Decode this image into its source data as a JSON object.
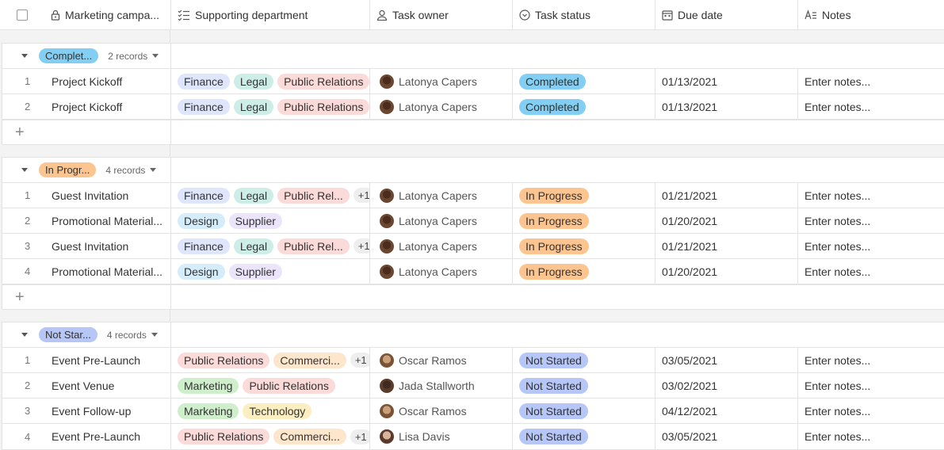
{
  "header": {
    "name_col": "Marketing campa...",
    "dept_col": "Supporting department",
    "owner_col": "Task owner",
    "status_col": "Task status",
    "due_col": "Due date",
    "notes_col": "Notes"
  },
  "colors": {
    "Finance": "#dfe6fb",
    "Legal": "#cdeee7",
    "Public Relations": "#fbdada",
    "Public Rel...": "#fbdada",
    "Design": "#d5ecfb",
    "Supplier": "#ece4fb",
    "Commerci...": "#fde6cc",
    "Marketing": "#cfeecc",
    "Technology": "#fbeec0",
    "Completed": "#82cff3",
    "In Progress": "#fcc48e",
    "Not Started": "#b5c6f7"
  },
  "groups": [
    {
      "label": "Complet...",
      "count": "2 records",
      "rows": [
        {
          "num": "1",
          "name": "Project Kickoff",
          "depts": [
            "Finance",
            "Legal",
            "Public Relations"
          ],
          "more": "",
          "owner": "Latonya Capers",
          "status": "Completed",
          "due": "01/13/2021",
          "notes": "Enter notes..."
        },
        {
          "num": "2",
          "name": "Project Kickoff",
          "depts": [
            "Finance",
            "Legal",
            "Public Relations"
          ],
          "more": "",
          "owner": "Latonya Capers",
          "status": "Completed",
          "due": "01/13/2021",
          "notes": "Enter notes..."
        }
      ]
    },
    {
      "label": "In Progr...",
      "count": "4 records",
      "rows": [
        {
          "num": "1",
          "name": "Guest Invitation",
          "depts": [
            "Finance",
            "Legal",
            "Public Rel..."
          ],
          "more": "+1",
          "owner": "Latonya Capers",
          "status": "In Progress",
          "due": "01/21/2021",
          "notes": "Enter notes..."
        },
        {
          "num": "2",
          "name": "Promotional Material...",
          "depts": [
            "Design",
            "Supplier"
          ],
          "more": "",
          "owner": "Latonya Capers",
          "status": "In Progress",
          "due": "01/20/2021",
          "notes": "Enter notes..."
        },
        {
          "num": "3",
          "name": "Guest Invitation",
          "depts": [
            "Finance",
            "Legal",
            "Public Rel..."
          ],
          "more": "+1",
          "owner": "Latonya Capers",
          "status": "In Progress",
          "due": "01/21/2021",
          "notes": "Enter notes..."
        },
        {
          "num": "4",
          "name": "Promotional Material...",
          "depts": [
            "Design",
            "Supplier"
          ],
          "more": "",
          "owner": "Latonya Capers",
          "status": "In Progress",
          "due": "01/20/2021",
          "notes": "Enter notes..."
        }
      ]
    },
    {
      "label": "Not Star...",
      "count": "4 records",
      "rows": [
        {
          "num": "1",
          "name": "Event Pre-Launch",
          "depts": [
            "Public Relations",
            "Commerci..."
          ],
          "more": "+1",
          "owner": "Oscar Ramos",
          "status": "Not Started",
          "due": "03/05/2021",
          "notes": "Enter notes..."
        },
        {
          "num": "2",
          "name": "Event Venue",
          "depts": [
            "Marketing",
            "Public Relations"
          ],
          "more": "",
          "owner": "Jada Stallworth",
          "status": "Not Started",
          "due": "03/02/2021",
          "notes": "Enter notes..."
        },
        {
          "num": "3",
          "name": "Event Follow-up",
          "depts": [
            "Marketing",
            "Technology"
          ],
          "more": "",
          "owner": "Oscar Ramos",
          "status": "Not Started",
          "due": "04/12/2021",
          "notes": "Enter notes..."
        },
        {
          "num": "4",
          "name": "Event Pre-Launch",
          "depts": [
            "Public Relations",
            "Commerci..."
          ],
          "more": "+1",
          "owner": "Lisa Davis",
          "status": "Not Started",
          "due": "03/05/2021",
          "notes": "Enter notes..."
        }
      ]
    }
  ]
}
